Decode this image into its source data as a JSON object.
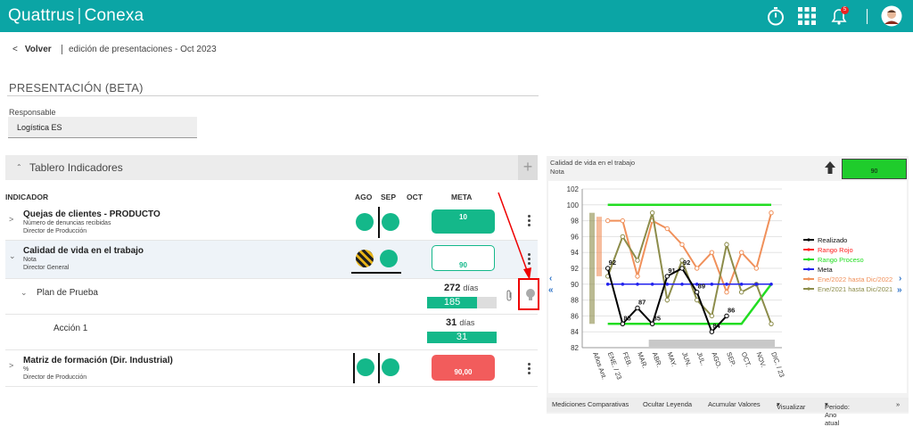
{
  "app": {
    "brand": "Quattrus",
    "brand_sep": "|",
    "product": "Conexa",
    "notif_count": "5"
  },
  "nav": {
    "back_label": "Volver",
    "breadcrumb": "edición de presentaciones - Oct 2023"
  },
  "page": {
    "title": "PRESENTACIÓN (BETA)",
    "responsable_label": "Responsable",
    "responsable_value": "Logística ES"
  },
  "board": {
    "title": "Tablero Indicadores",
    "cols": {
      "indicador": "INDICADOR",
      "ago": "AGO",
      "sep": "SEP",
      "oct": "OCT",
      "meta": "META"
    }
  },
  "rows": [
    {
      "name": "Quejas de clientes - PRODUCTO",
      "sub1": "Número de denuncias recibidas",
      "sub2": "Director de Producción",
      "meta": "10"
    },
    {
      "name": "Calidad de vida en el trabajo",
      "sub1": "Nota",
      "sub2": "Director General",
      "meta": "90"
    },
    {
      "name": "Plan de Prueba",
      "days": "272",
      "days_unit": "días",
      "bar": "185",
      "progress": 0.72
    },
    {
      "name": "Acción 1",
      "days": "31",
      "days_unit": "días",
      "bar": "31",
      "progress": 1.0
    },
    {
      "name": "Matriz de formación (Dir. Industrial)",
      "sub1": "%",
      "sub2": "Director de Producción",
      "meta": "90,00"
    }
  ],
  "colors": {
    "teal": "#0ba5a5",
    "green": "#14b88a",
    "red": "#f25c5c",
    "hatch_yellow": "#e7b417"
  },
  "icons": [
    "stopwatch-icon",
    "grid-apps-icon",
    "bell-icon",
    "avatar",
    "chevron-left-icon",
    "plus-icon",
    "kebab-icon",
    "paperclip-icon",
    "lightbulb-icon",
    "arrow-up-icon"
  ],
  "chart_panel": {
    "title": "Calidad de vida en el trabajo",
    "subtitle": "Nota",
    "status_value": "90"
  },
  "chart_data": {
    "type": "line",
    "categories": [
      "Años Ant.",
      "ENE. / 23",
      "FEB.",
      "MAR.",
      "ABR.",
      "MAY.",
      "JUN.",
      "JUL.",
      "AGO.",
      "SEP.",
      "OCT.",
      "NOV.",
      "DIC. / 23"
    ],
    "ylim": [
      82,
      102
    ],
    "yticks": [
      82,
      84,
      86,
      88,
      90,
      92,
      94,
      96,
      98,
      100,
      102
    ],
    "series": [
      {
        "name": "Realizado",
        "color": "#000000",
        "values": [
          null,
          92,
          85,
          87,
          85,
          91,
          92,
          89,
          84,
          86,
          null,
          null,
          null
        ],
        "labels": [
          "",
          "92",
          "85",
          "87",
          "85",
          "91",
          "92",
          "89",
          "84",
          "86",
          "",
          "",
          ""
        ]
      },
      {
        "name": "Rango Rojo",
        "color": "#ff2020",
        "values": []
      },
      {
        "name": "Rango Proceso",
        "color": "#22dd22",
        "values": [
          null,
          85,
          85,
          85,
          85,
          85,
          85,
          85,
          85,
          85,
          85,
          87.5,
          90
        ],
        "values_upper": [
          null,
          100,
          100,
          100,
          100,
          100,
          100,
          100,
          100,
          100,
          100,
          100,
          100
        ]
      },
      {
        "name": "Meta",
        "color": "#2222ee",
        "values": [
          null,
          90,
          90,
          90,
          90,
          90,
          90,
          90,
          90,
          90,
          90,
          90,
          90
        ]
      },
      {
        "name": "Ene/2022 hasta Dic/2022",
        "color": "#f0905a",
        "values": [
          95,
          98,
          98,
          91,
          98,
          97,
          95,
          92,
          94,
          89,
          94,
          92,
          99
        ]
      },
      {
        "name": "Ene/2021 hasta Dic/2021",
        "color": "#8c8c4a",
        "values": [
          91.5,
          91,
          96,
          93,
          99,
          88,
          93,
          88,
          86,
          95,
          89,
          90,
          85
        ]
      }
    ],
    "legend": "right",
    "grid": true
  },
  "chart_footer": [
    "Mediciones Comparativas",
    "Ocultar Leyenda",
    "Acumular Valores",
    "Visualizar",
    "Periodo: Ano atual"
  ]
}
